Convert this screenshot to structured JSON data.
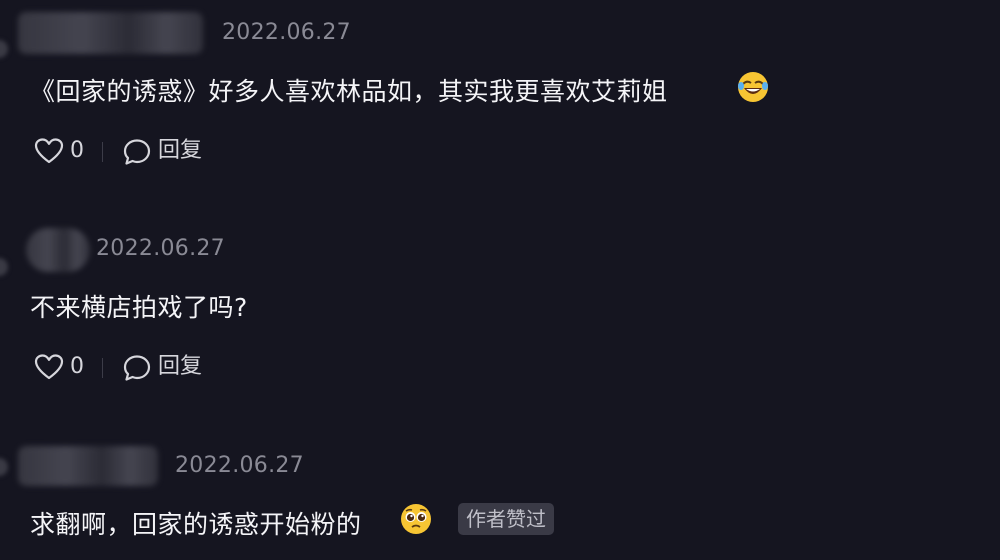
{
  "comments": [
    {
      "date": "2022.06.27",
      "text": "《回家的诱惑》好多人喜欢林品如，其实我更喜欢艾莉姐",
      "emoji": "rofl",
      "likes": "0",
      "reply_label": "回复"
    },
    {
      "date": "2022.06.27",
      "text": "不来横店拍戏了吗?",
      "likes": "0",
      "reply_label": "回复"
    },
    {
      "date": "2022.06.27",
      "text": "求翻啊，回家的诱惑开始粉的",
      "emoji": "pleading",
      "badge": "作者赞过"
    }
  ],
  "colors": {
    "background": "#151520",
    "text": "#f4f4f7",
    "muted": "#8a8a95",
    "badge_bg": "#3a3a46"
  }
}
